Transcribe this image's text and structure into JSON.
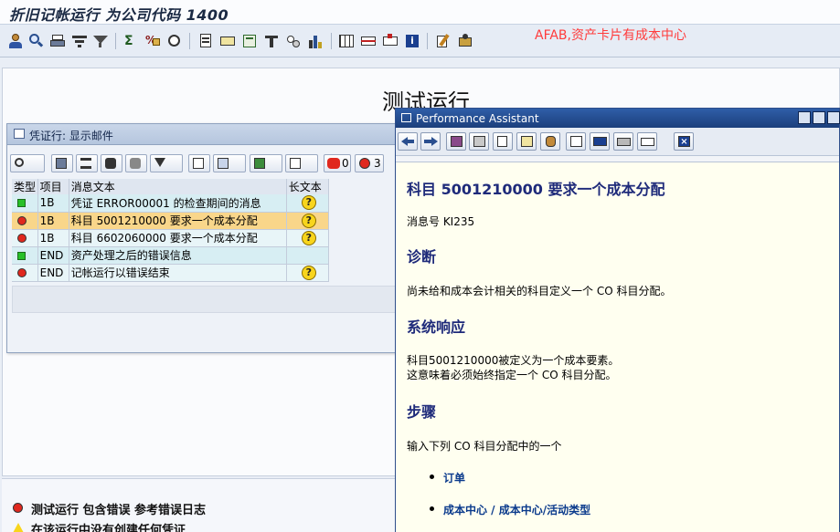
{
  "window": {
    "title": "折旧记帐运行 为公司代码 1400"
  },
  "annotation": "AFAB,资产卡片有成本中心",
  "main": {
    "title": "测试运行",
    "status": [
      {
        "icon": "red-led-icon",
        "text": "测试运行 包含错误 参考错误日志"
      },
      {
        "icon": "warning-triangle-icon",
        "text": "在该运行中没有创建任何凭证"
      }
    ]
  },
  "message_dialog": {
    "title": "凭证行: 显示邮件",
    "counts": {
      "stop": "0",
      "error": "3"
    },
    "columns": [
      "类型",
      "项目",
      "消息文本",
      "长文本"
    ],
    "rows": [
      {
        "type": "green",
        "item": "1B",
        "text": "凭证 ERROR00001 的检查期间的消息",
        "selected": false
      },
      {
        "type": "red",
        "item": "1B",
        "text": "科目 5001210000 要求一个成本分配",
        "selected": true
      },
      {
        "type": "red",
        "item": "1B",
        "text": "科目 6602060000 要求一个成本分配",
        "selected": false
      },
      {
        "type": "green",
        "item": "END",
        "text": "资产处理之后的错误信息",
        "selected": false
      },
      {
        "type": "red",
        "item": "END",
        "text": "记帐运行以错误结束",
        "selected": false
      }
    ],
    "longtext_symbol": "?"
  },
  "performance_assistant": {
    "title": "Performance Assistant",
    "heading": "科目  5001210000 要求一个成本分配",
    "message_no": "消息号  KI235",
    "diagnosis_title": "诊断",
    "diagnosis_text": "尚未给和成本会计相关的科目定义一个  CO 科目分配。",
    "response_title": "系统响应",
    "response_text1": "科目5001210000被定义为一个成本要素。",
    "response_text2": "这意味着必须始终指定一个  CO 科目分配。",
    "steps_title": "步骤",
    "steps_text": "输入下列  CO 科目分配中的一个",
    "steps": [
      "订单",
      "成本中心  / 成本中心/活动类型"
    ]
  },
  "colors": {
    "red": "#e0281e",
    "green": "#28c028",
    "warning": "#f8d51c",
    "accent": "#1e2a7a"
  }
}
